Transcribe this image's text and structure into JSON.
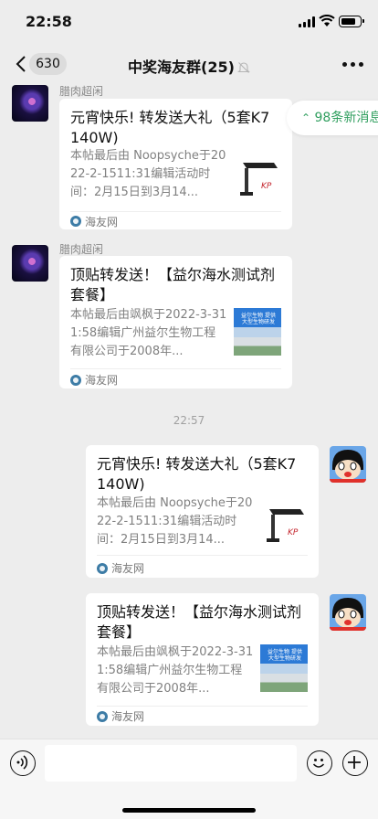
{
  "status": {
    "time": "22:58"
  },
  "nav": {
    "unread": "630",
    "title": "中奖海友群(25)"
  },
  "chat": {
    "new_messages": "98条新消息",
    "timestamp": "22:57",
    "messages": [
      {
        "sender": "腊肉超闲",
        "title": "元宵快乐! 转发送大礼（5套K7  140W)",
        "desc": "本帖最后由 Noopsyche于2022-2-1511:31编辑活动时间：2月15日到3月14...",
        "source": "海友网"
      },
      {
        "sender": "腊肉超闲",
        "title": "顶贴转发送！【益尔海水测试剂套餐】",
        "desc": "本帖最后由飒枫于2022-3-311:58编辑广州益尔生物工程有限公司于2008年...",
        "source": "海友网",
        "thumb_text": "益尔生物 提供大型生物研发"
      },
      {
        "title": "元宵快乐! 转发送大礼（5套K7  140W)",
        "desc": "本帖最后由 Noopsyche于2022-2-1511:31编辑活动时间：2月15日到3月14...",
        "source": "海友网"
      },
      {
        "title": "顶贴转发送！【益尔海水测试剂套餐】",
        "desc": "本帖最后由飒枫于2022-3-311:58编辑广州益尔生物工程有限公司于2008年...",
        "source": "海友网",
        "thumb_text": "益尔生物 提供大型生物研发"
      }
    ]
  },
  "colors": {
    "background": "#ededed",
    "accent_green": "#2f9e5e",
    "card": "#ffffff"
  },
  "icons": [
    "back-chevron-icon",
    "mute-bell-icon",
    "more-icon",
    "voice-icon",
    "emoji-icon",
    "plus-icon",
    "double-chevron-up-icon",
    "source-globe-icon"
  ]
}
